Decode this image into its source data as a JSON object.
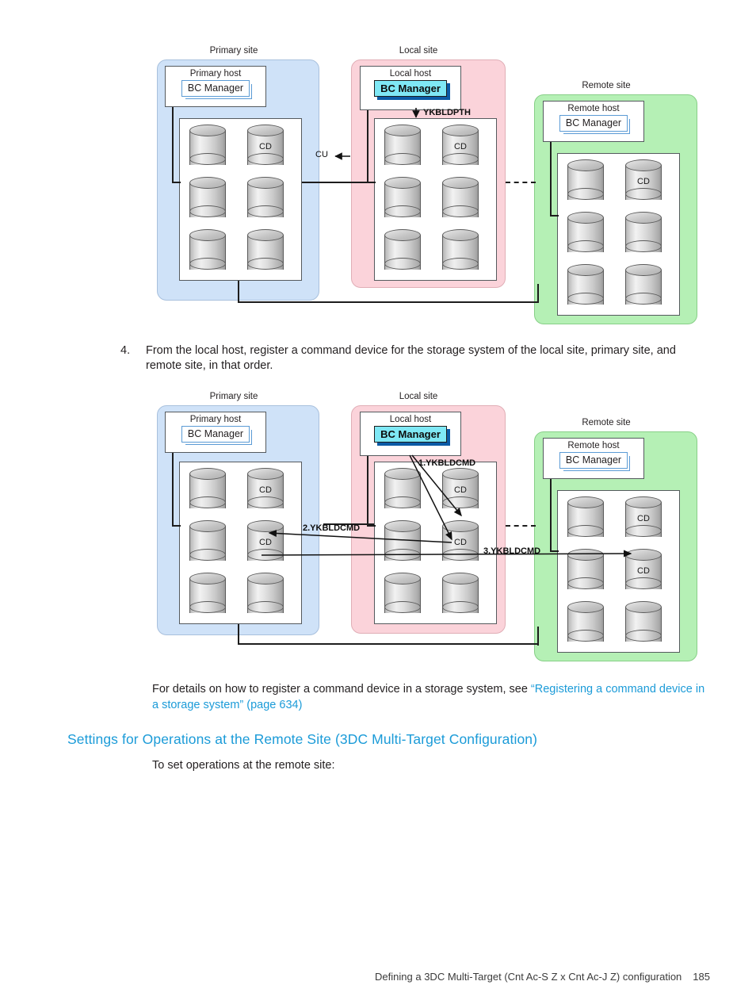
{
  "document": {
    "footer_title": "Defining a 3DC Multi-Target (Cnt Ac-S Z x Cnt Ac-J Z) configuration",
    "page_number": "185"
  },
  "step4": {
    "number": "4.",
    "text": "From the local host, register a command device for the storage system of the local site, primary site, and remote site, in that order."
  },
  "details_para": {
    "lead": "For details on how to register a command device in a storage system, see ",
    "link": "“Registering a command device in a storage system” (page 634)"
  },
  "heading": {
    "text": "Settings for Operations at the Remote Site (3DC Multi-Target Configuration)"
  },
  "intro": {
    "text": "To set operations at the remote site:"
  },
  "figure1": {
    "sites": {
      "primary": {
        "label": "Primary site",
        "host_title": "Primary host",
        "bcm": "BC Manager"
      },
      "local": {
        "label": "Local site",
        "host_title": "Local host",
        "bcm": "BC Manager"
      },
      "remote": {
        "label": "Remote site",
        "host_title": "Remote host",
        "bcm": "BC Manager"
      }
    },
    "annotations": {
      "cu": "CU",
      "command": "YKBLDPTH"
    },
    "cd_labels": {
      "primary": "CD",
      "local": "CD",
      "remote": "CD"
    },
    "colors": {
      "primary_fill": "#cfe2f8",
      "local_fill": "#fbd3da",
      "remote_fill": "#b5f0b5",
      "active_bcm_fill": "#7fe8f5",
      "active_bcm_shadow": "#0b5aa5"
    }
  },
  "figure2": {
    "sites": {
      "primary": {
        "label": "Primary site",
        "host_title": "Primary host",
        "bcm": "BC Manager"
      },
      "local": {
        "label": "Local site",
        "host_title": "Local host",
        "bcm": "BC Manager"
      },
      "remote": {
        "label": "Remote site",
        "host_title": "Remote host",
        "bcm": "BC Manager"
      }
    },
    "annotations": {
      "step1": "1.YKBLDCMD",
      "step2": "2.YKBLDCMD",
      "step3": "3.YKBLDCMD"
    },
    "cd_labels": {
      "primary_upper": "CD",
      "primary_lower": "CD",
      "local_upper": "CD",
      "local_lower": "CD",
      "remote_upper": "CD",
      "remote_lower": "CD"
    },
    "colors": {
      "primary_fill": "#cfe2f8",
      "local_fill": "#fbd3da",
      "remote_fill": "#b5f0b5",
      "active_bcm_fill": "#7fe8f5",
      "active_bcm_shadow": "#0b5aa5"
    }
  },
  "theme": {
    "link_color": "#1b9bd8",
    "heading_color": "#1b9bd8",
    "text_color": "#231f20"
  }
}
